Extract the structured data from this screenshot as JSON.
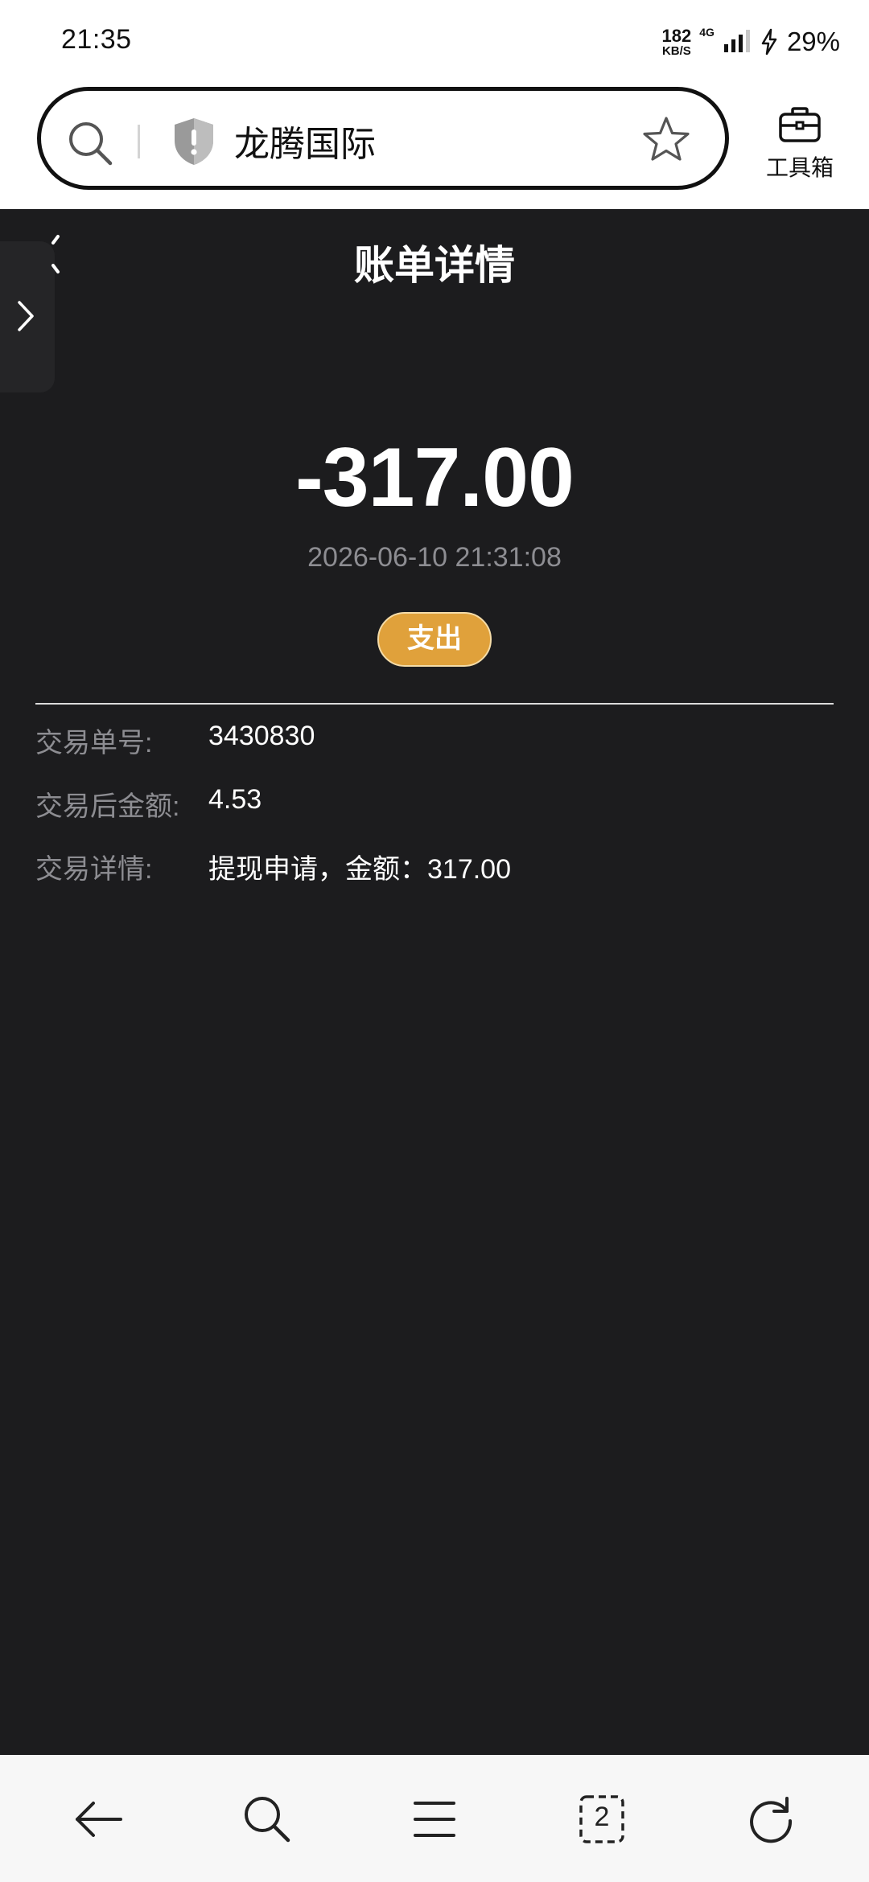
{
  "status_bar": {
    "time": "21:35",
    "speed_value": "182",
    "speed_unit": "KB/S",
    "network": "4G",
    "battery": "29%"
  },
  "browser": {
    "address_text": "龙腾国际",
    "toolbox_label": "工具箱",
    "tab_count": "2"
  },
  "page": {
    "title": "账单详情",
    "amount": "-317.00",
    "datetime": "2026-06-10 21:31:08",
    "type_badge": "支出",
    "rows": [
      {
        "label": "交易单号:",
        "value": "3430830"
      },
      {
        "label": "交易后金额:",
        "value": "4.53"
      },
      {
        "label": "交易详情:",
        "value": "提现申请，金额：317.00"
      }
    ]
  },
  "colors": {
    "page_background": "#1c1c1e",
    "badge": "#e0a13b",
    "muted_text": "#8d8d92"
  },
  "icons": {
    "address_bar": [
      "search-icon",
      "shield-warning-icon",
      "star-icon",
      "toolbox-icon"
    ],
    "bottom_nav": [
      "back-arrow-icon",
      "search-icon",
      "menu-icon",
      "tabs-icon",
      "refresh-icon"
    ],
    "page": [
      "chevron-right-icon"
    ]
  }
}
